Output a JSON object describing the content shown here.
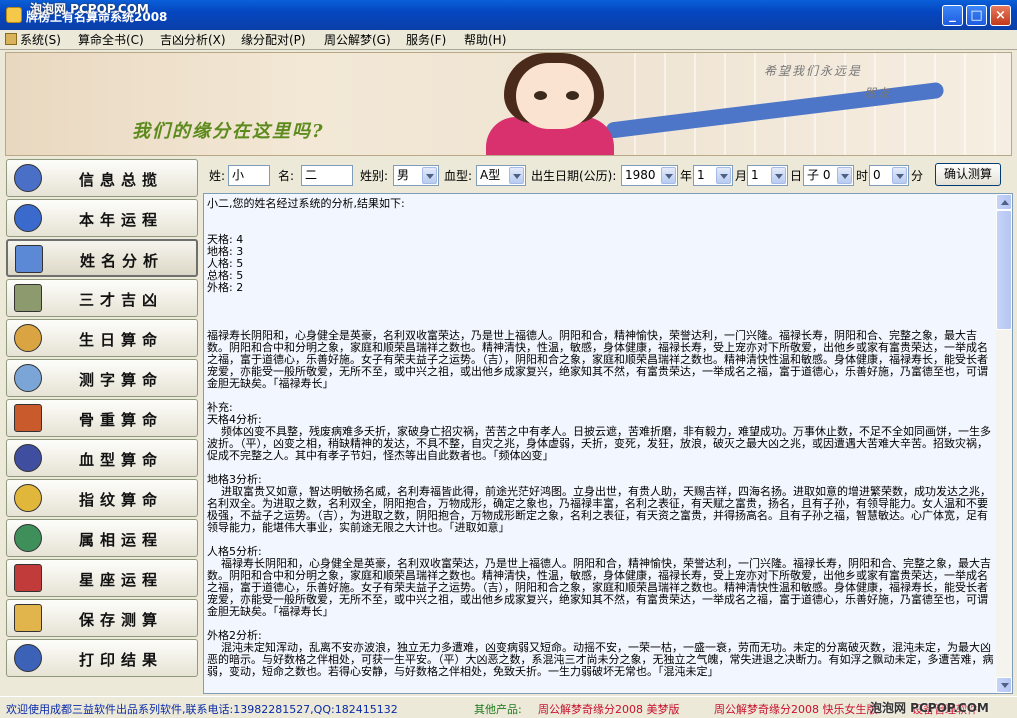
{
  "window": {
    "title": "牌榜上有名算命系统2008",
    "watermark_top": "泡泡网 PCPOP.COM",
    "watermark_bottom": "泡泡网 PCPOP.COM"
  },
  "menu": [
    {
      "label": "系统(S)"
    },
    {
      "label": "算命全书(C)"
    },
    {
      "label": "吉凶分析(X)"
    },
    {
      "label": "缘分配对(P)"
    },
    {
      "label": "周公解梦(G)"
    },
    {
      "label": "服务(F)"
    },
    {
      "label": "帮助(H)"
    }
  ],
  "banner": {
    "slogan": "我们的缘分在这里吗?",
    "quote_line1": "希望我们永远是",
    "quote_line2": "朋友"
  },
  "sidebar": [
    {
      "label": "信息总揽",
      "icon": "globe-icon",
      "color": "#4A6FC7"
    },
    {
      "label": "本年运程",
      "icon": "eye-icon",
      "color": "#3A6ACB"
    },
    {
      "label": "姓名分析",
      "icon": "document-icon",
      "color": "#5C89D6"
    },
    {
      "label": "三才吉凶",
      "icon": "box-icon",
      "color": "#8C9A6E"
    },
    {
      "label": "生日算命",
      "icon": "star-burst-icon",
      "color": "#D9A441"
    },
    {
      "label": "测字算命",
      "icon": "pen-icon",
      "color": "#7AA5D6"
    },
    {
      "label": "骨重算命",
      "icon": "grid-icon",
      "color": "#C85A2B"
    },
    {
      "label": "血型算命",
      "icon": "gear-icon",
      "color": "#3F4E9E"
    },
    {
      "label": "指纹算命",
      "icon": "star-icon",
      "color": "#E0B73A"
    },
    {
      "label": "属相运程",
      "icon": "tree-icon",
      "color": "#3E8F5A"
    },
    {
      "label": "星座运程",
      "icon": "chart-icon",
      "color": "#C23B3B"
    },
    {
      "label": "保存测算",
      "icon": "folder-icon",
      "color": "#E2B54C"
    },
    {
      "label": "打印结果",
      "icon": "printer-icon",
      "color": "#3C62B7"
    }
  ],
  "form": {
    "surname_label": "姓:",
    "surname_value": "小",
    "name_label": "名:",
    "name_value": "二",
    "gender_label": "姓别:",
    "gender_value": "男",
    "blood_label": "血型:",
    "blood_value": "A型",
    "birth_label": "出生日期(公历):",
    "year_value": "1980",
    "year_label": "年",
    "month_value": "1",
    "month_label": "月",
    "day_value": "1",
    "day_label": "日",
    "hour_value": "子 0",
    "hour_label": "时",
    "minute_value": "0",
    "minute_label": "分",
    "submit_label": "确认测算"
  },
  "result": [
    "小二,您的姓名经过系统的分析,结果如下:",
    "",
    "",
    "天格: 4",
    "地格: 3",
    "人格: 5",
    "总格: 5",
    "外格: 2",
    "",
    "",
    "",
    "福禄寿长阴阳和，心身健全是英豪，名利双收富荣达，乃是世上福德人。阴阳和合，精神愉快，荣誉达利，一门兴隆。福禄长寿，阴阳和合、完整之象，最大吉数。阴阳和合中和分明之象，家庭和顺荣昌瑞祥之数也。精神清快，性温，敏感，身体健康，福禄长寿，受上宠亦对下所敬爱，出他乡或家有富贵荣达，一举成名之福，富于道德心，乐善好施。女子有荣夫益子之运势。（吉），阴阳和合之象，家庭和顺荣昌瑞祥之数也。精神清快性温和敏感。身体健康，福禄寿长，能受长者宠爱，亦能受一般所敬爱，无所不至，或中兴之祖，或出他乡成家复兴，绝家知其不然，有富贵荣达，一举成名之福，富于道德心，乐善好施，乃富德至也，可谓金胆无缺矣。「福禄寿长」",
    "",
    "补充:",
    "天格4分析:",
    "    频体凶变不具整，残废病难多夭折，家破身亡招灾祸，苦苦之中有孝人。日披云遮，苦难折磨，非有毅力，难望成功。万事休止数，不足不全如同画饼，一生多波折。（平），凶变之相，稍缺精神的发达，不具不整，自灾之兆，身体虚弱，夭折，变死，发狂，放浪，破灭之最大凶之兆，或因遭遇大苦难大辛苦。招致灾祸，促成不完整之人。其中有孝子节妇，怪杰等出自此数者也。「频体凶变」",
    "",
    "地格3分析:",
    "    进取富贵又如意，智达明敏扬名威，名利寿福皆此得，前途光茫好鸿图。立身出世，有贵人助，天赐吉祥，四海名扬。进取如意的增进繁荣数，成功发达之兆，名利双全。为进取之数，名利双全，阴阳抱合，万物成形，确定之象也，乃福禄丰富，名利之表征，有天赋之富贵，扬名，且有子孙，有领导能力。女人温和不要极强，不益子之运势。（吉），为进取之数，阴阳抱合，万物成形断定之象，名利之表征，有天资之富贵，并得扬高名。且有子孙之福，智慧敏达。心广体宽，足有领导能力，能堪伟大事业，实前途无限之大计也。「进取如意」",
    "",
    "人格5分析:",
    "    福禄寿长阴阳和，心身健全是英豪，名利双收富荣达，乃是世上福德人。阴阳和合，精神愉快，荣誉达利，一门兴隆。福禄长寿，阴阳和合、完整之象，最大吉数。阴阳和合中和分明之象，家庭和顺荣昌瑞祥之数也。精神清快，性温，敏感，身体健康，福禄长寿，受上宠亦对下所敬爱，出他乡或家有富贵荣达，一举成名之福，富于道德心，乐善好施。女子有荣夫益子之运势。（吉），阴阳和合之象，家庭和顺荣昌瑞祥之数也。精神清快性温和敏感。身体健康，福禄寿长，能受长者宠爱，亦能受一般所敬爱，无所不至，或中兴之祖，或出他乡成家复兴，绝家知其不然，有富贵荣达，一举成名之福，富于道德心，乐善好施，乃富德至也，可谓金胆无缺矣。「福禄寿长」",
    "",
    "外格2分析:",
    "    混沌未定知浑动，乱离不安亦波浪，独立无力多遭难，凶变病弱又短命。动摇不安，一荣一枯，一盛一衰，劳而无功。未定的分离破灭数，混沌未定，为最大凶恶的暗示。与好数格之伴相处，可获一生平安。（平）大凶恶之数，系混沌三才尚未分之象，无独立之气魄，常失进退之决断力。有如浮之飘动未定，多遭苦难，病弱，变动，短命之数也。若得心安静，与好数格之伴相处，免致夭折。一生力弱破坏无常也。「混沌未定」"
  ],
  "status": {
    "welcome": "欢迎使用成都三益软件出品系列软件,联系电话:13982281527,QQ:182415132",
    "other_label": "其他产品:",
    "product1": "周公解梦奇缘分2008  美梦版",
    "product2": "周公解梦奇缘分2008  快乐女生版",
    "product3": "设备管理软件",
    "colors": {
      "blue": "#0A2BA8",
      "green": "#1F7A1F",
      "red": "#C8102E"
    }
  }
}
